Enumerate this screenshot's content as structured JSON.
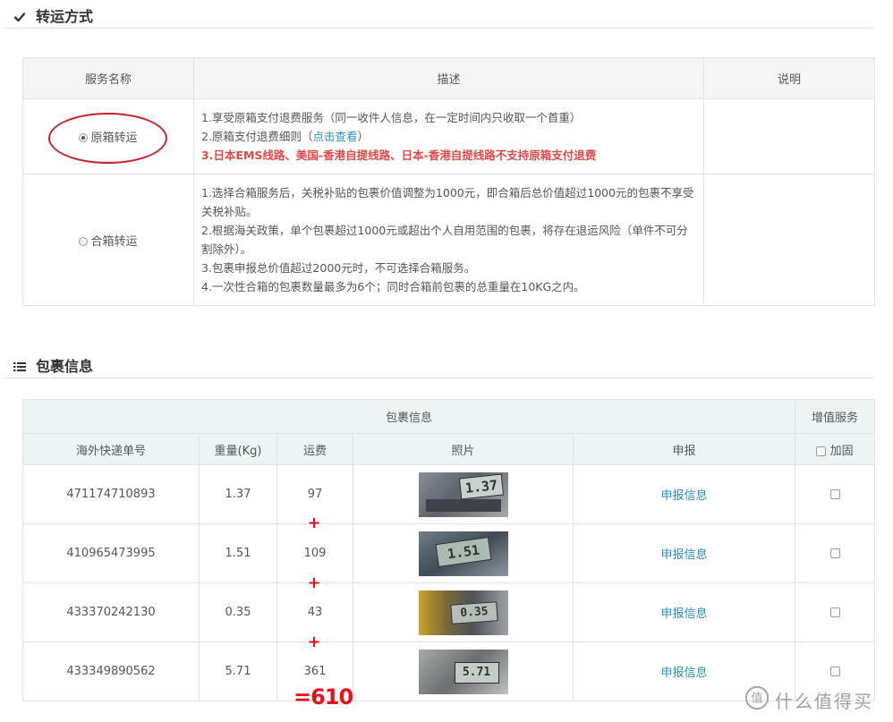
{
  "shipping": {
    "section_title": "转运方式",
    "headers": [
      "服务名称",
      "描述",
      "说明"
    ],
    "options": [
      {
        "label": "原箱转运",
        "selected": true,
        "lines": [
          "1.享受原箱支付退费服务（同一收件人信息，在一定时间内只收取一个首重）",
          "2.原箱支付退费细则（",
          "点击查看",
          "）",
          "3.日本EMS线路、美国-香港自提线路、日本-香港自提线路不支持原箱支付退费"
        ]
      },
      {
        "label": "合箱转运",
        "selected": false,
        "lines": [
          "1.选择合箱服务后，关税补贴的包裹价值调整为1000元，即合箱后总价值超过1000元的包裹不享受关税补贴。",
          "2.根据海关政策，单个包裹超过1000元或超出个人自用范围的包裹，将存在退运风险（单件不可分割除外）。",
          "3.包裹申报总价值超过2000元时，不可选择合箱服务。",
          "4.一次性合箱的包裹数量最多为6个；同时合箱前包裹的总重量在10KG之内。"
        ]
      }
    ]
  },
  "packages": {
    "section_title": "包裹信息",
    "group_header": "包裹信息",
    "value_added_header": "增值服务",
    "columns": [
      "海外快递单号",
      "重量(Kg)",
      "运费",
      "照片",
      "申报"
    ],
    "reinforce_label": "加固",
    "rows": [
      {
        "tracking": "471174710893",
        "weight": "1.37",
        "fee": "97",
        "declare": "申报信息",
        "scale_reading": "1.37",
        "reinforce": false
      },
      {
        "tracking": "410965473995",
        "weight": "1.51",
        "fee": "109",
        "declare": "申报信息",
        "scale_reading": "1.51",
        "reinforce": false
      },
      {
        "tracking": "433370242130",
        "weight": "0.35",
        "fee": "43",
        "declare": "申报信息",
        "scale_reading": "0.35",
        "reinforce": false
      },
      {
        "tracking": "433349890562",
        "weight": "5.71",
        "fee": "361",
        "declare": "申报信息",
        "scale_reading": "5.71",
        "reinforce": false
      }
    ],
    "annotation_plus": "+",
    "annotation_total": "=610"
  },
  "watermark": {
    "text": "什么值得买",
    "logo_char": "值"
  },
  "colors": {
    "accent_link": "#2a8fbd",
    "warning_red": "#e44848",
    "annotation_red": "#e8101a",
    "header_bg": "#eef4f4"
  }
}
